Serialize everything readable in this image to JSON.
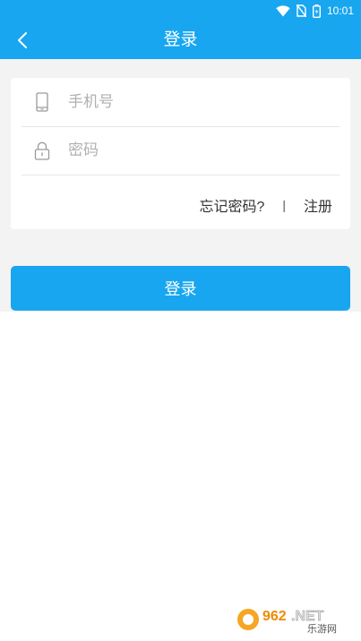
{
  "status_bar": {
    "time": "10:01",
    "icons": [
      "wifi-icon",
      "no-sim-icon",
      "battery-icon"
    ]
  },
  "app_bar": {
    "title": "登录",
    "back_icon": "chevron-left-icon"
  },
  "form": {
    "phone_placeholder": "手机号",
    "password_placeholder": "密码",
    "phone_icon": "phone-icon",
    "password_icon": "lock-icon"
  },
  "links": {
    "forgot_password": "忘记密码?",
    "separator": "|",
    "register": "注册"
  },
  "login_button": "登录",
  "watermark": {
    "brand": "962.NET",
    "subtitle": "乐游网"
  },
  "colors": {
    "primary": "#18a6f0",
    "background": "#f3f3f3",
    "card": "#ffffff",
    "placeholder": "#b0b0b0"
  }
}
